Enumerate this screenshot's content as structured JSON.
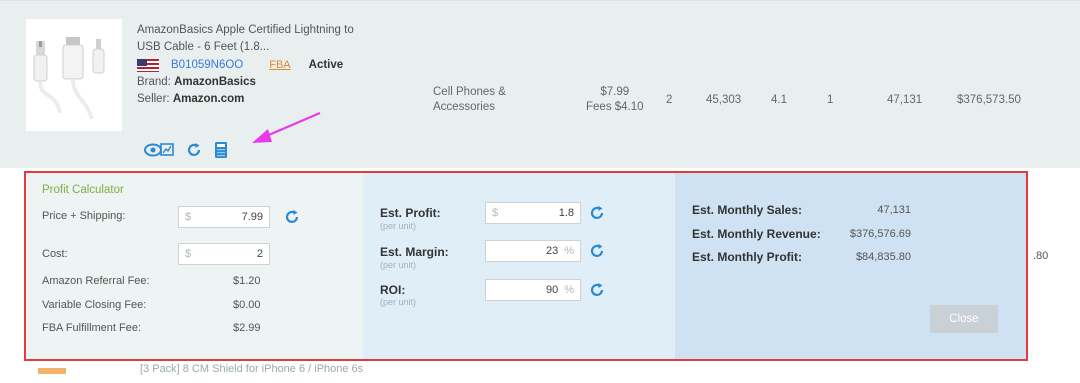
{
  "product": {
    "title_line1": "AmazonBasics Apple Certified Lightning to",
    "title_line2": "USB Cable - 6 Feet (1.8...",
    "asin": "B01059N6OO",
    "fba_label": "FBA",
    "status": "Active",
    "brand_label": "Brand:",
    "brand": "AmazonBasics",
    "seller_label": "Seller:",
    "seller": "Amazon.com",
    "category_line1": "Cell Phones &",
    "category_line2": "Accessories",
    "price": "$7.99",
    "fees": "Fees $4.10",
    "sellers": "2",
    "rank": "45,303",
    "rating": "4.1",
    "reviews": "1",
    "est_sales": "47,131",
    "est_revenue": "$376,573.50"
  },
  "calculator": {
    "title": "Profit Calculator",
    "price_label": "Price + Shipping:",
    "price_currency": "$",
    "price_value": "7.99",
    "cost_label": "Cost:",
    "cost_currency": "$",
    "cost_value": "2",
    "referral_label": "Amazon Referral Fee:",
    "referral_value": "$1.20",
    "closing_label": "Variable Closing Fee:",
    "closing_value": "$0.00",
    "fba_label": "FBA Fulfillment Fee:",
    "fba_value": "$2.99",
    "profit_label": "Est. Profit:",
    "profit_per": "(per unit)",
    "profit_currency": "$",
    "profit_value": "1.8",
    "margin_label": "Est. Margin:",
    "margin_per": "(per unit)",
    "margin_value": "23",
    "margin_unit": "%",
    "roi_label": "ROI:",
    "roi_per": "(per unit)",
    "roi_value": "90",
    "roi_unit": "%",
    "monthly_sales_label": "Est. Monthly Sales:",
    "monthly_sales_value": "47,131",
    "monthly_revenue_label": "Est. Monthly Revenue:",
    "monthly_revenue_value": "$376,576.69",
    "monthly_profit_label": "Est. Monthly Profit:",
    "monthly_profit_value": "$84,835.80",
    "close_label": "Close"
  },
  "background": {
    "side_fragment": ".80",
    "next_row_fragment": "[3 Pack] 8 CM Shield for iPhone 6 / iPhone 6s"
  },
  "colors": {
    "highlight_border": "#e23c3c",
    "accent_blue": "#3a7bd5",
    "fba_orange": "#e08a2a",
    "title_green": "#7ab040",
    "arrow_magenta": "#e83ae8"
  }
}
